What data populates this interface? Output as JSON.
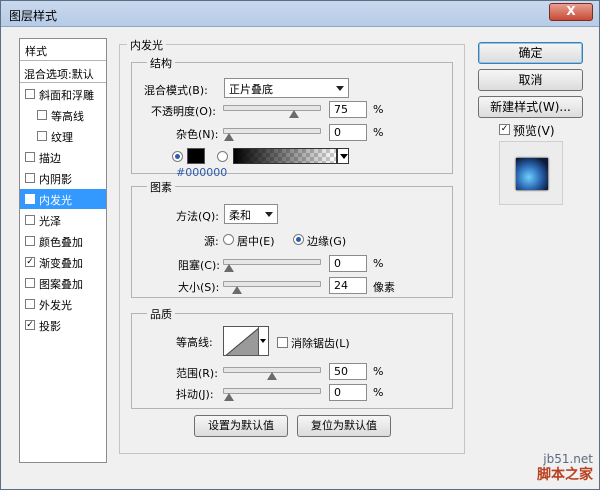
{
  "window": {
    "title": "图层样式",
    "close": "X"
  },
  "left": {
    "header": "样式",
    "blend_options": "混合选项:默认",
    "items": [
      {
        "label": "斜面和浮雕",
        "checked": false,
        "indent": false
      },
      {
        "label": "等高线",
        "checked": false,
        "indent": true
      },
      {
        "label": "纹理",
        "checked": false,
        "indent": true
      },
      {
        "label": "描边",
        "checked": false,
        "indent": false
      },
      {
        "label": "内阴影",
        "checked": false,
        "indent": false
      },
      {
        "label": "内发光",
        "checked": true,
        "indent": false,
        "selected": true
      },
      {
        "label": "光泽",
        "checked": false,
        "indent": false
      },
      {
        "label": "颜色叠加",
        "checked": false,
        "indent": false
      },
      {
        "label": "渐变叠加",
        "checked": true,
        "indent": false
      },
      {
        "label": "图案叠加",
        "checked": false,
        "indent": false
      },
      {
        "label": "外发光",
        "checked": false,
        "indent": false
      },
      {
        "label": "投影",
        "checked": true,
        "indent": false
      }
    ]
  },
  "inner_glow": {
    "title": "内发光",
    "structure": {
      "title": "结构",
      "blend_mode_label": "混合模式(B):",
      "blend_mode_value": "正片叠底",
      "opacity_label": "不透明度(O):",
      "opacity_value": "75",
      "opacity_unit": "%",
      "opacity_level": 0.75,
      "noise_label": "杂色(N):",
      "noise_value": "0",
      "noise_unit": "%",
      "noise_level": 0,
      "color_hex": "#000000",
      "color_text": "#000000"
    },
    "elements": {
      "title": "图素",
      "technique_label": "方法(Q):",
      "technique_value": "柔和",
      "source_label": "源:",
      "source_center": "居中(E)",
      "source_edge": "边缘(G)",
      "choke_label": "阻塞(C):",
      "choke_value": "0",
      "choke_unit": "%",
      "choke_level": 0,
      "size_label": "大小(S):",
      "size_value": "24",
      "size_unit": "像素",
      "size_level": 0.097
    },
    "quality": {
      "title": "品质",
      "contour_label": "等高线:",
      "antialias_label": "消除锯齿(L)",
      "range_label": "范围(R):",
      "range_value": "50",
      "range_unit": "%",
      "range_level": 0.5,
      "jitter_label": "抖动(J):",
      "jitter_value": "0",
      "jitter_unit": "%",
      "jitter_level": 0
    },
    "make_default": "设置为默认值",
    "reset_default": "复位为默认值"
  },
  "buttons": {
    "ok": "确定",
    "cancel": "取消",
    "new_style": "新建样式(W)...",
    "preview_label": "预览(V)",
    "preview_checked": true
  },
  "watermark": {
    "url": "jb51.net",
    "site": "脚本之家"
  },
  "colors": {
    "selection": "#3399ff",
    "accent_text": "#2b5aa8"
  }
}
